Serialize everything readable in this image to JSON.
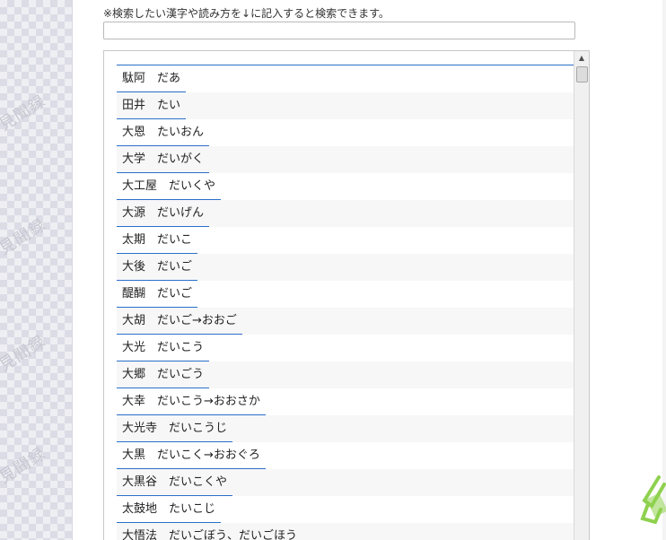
{
  "watermark": {
    "text": "見聞録"
  },
  "search": {
    "notice": "※検索したい漢字や読み方を↓に記入すると検索できます。",
    "value": ""
  },
  "scrollbar": {
    "up_arrow": "▲"
  },
  "entries": [
    {
      "kanji": "駄阿",
      "reading": "だあ"
    },
    {
      "kanji": "田井",
      "reading": "たい"
    },
    {
      "kanji": "大恩",
      "reading": "たいおん"
    },
    {
      "kanji": "大学",
      "reading": "だいがく"
    },
    {
      "kanji": "大工屋",
      "reading": "だいくや"
    },
    {
      "kanji": "大源",
      "reading": "だいげん"
    },
    {
      "kanji": "太期",
      "reading": "だいこ"
    },
    {
      "kanji": "大後",
      "reading": "だいご"
    },
    {
      "kanji": "醍醐",
      "reading": "だいご"
    },
    {
      "kanji": "大胡",
      "reading": "だいご→おおご"
    },
    {
      "kanji": "大光",
      "reading": "だいこう"
    },
    {
      "kanji": "大郷",
      "reading": "だいごう"
    },
    {
      "kanji": "大幸",
      "reading": "だいこう→おおさか"
    },
    {
      "kanji": "大光寺",
      "reading": "だいこうじ"
    },
    {
      "kanji": "大黒",
      "reading": "だいこく→おおぐろ"
    },
    {
      "kanji": "大黒谷",
      "reading": "だいこくや"
    },
    {
      "kanji": "太鼓地",
      "reading": "たいこじ"
    },
    {
      "kanji": "大悟法",
      "reading": "だいごぼう、だいごほう"
    }
  ],
  "colors": {
    "link_underline": "#2a6fc9",
    "row_shade": "#f7f7f7",
    "clip_green": "#8fd14f"
  }
}
